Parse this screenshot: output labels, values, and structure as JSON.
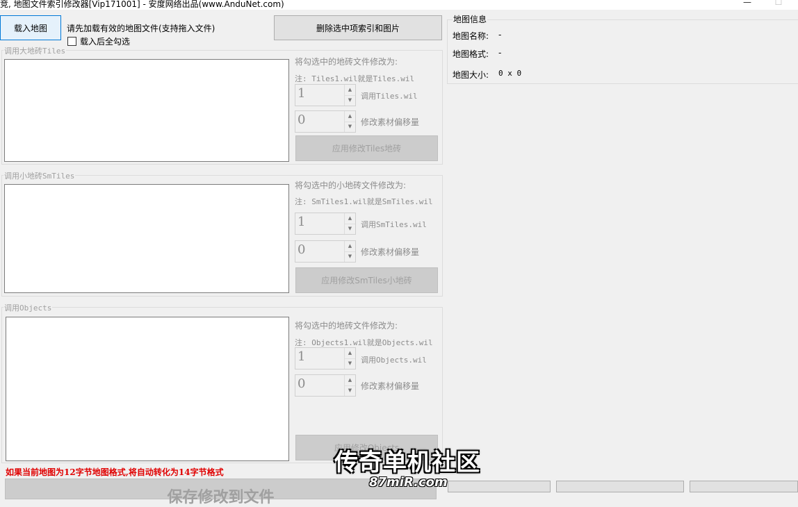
{
  "window": {
    "title": "竞, 地图文件索引修改器[Vip171001] - 安度网络出品(www.AnduNet.com)",
    "minimize_glyph": "—",
    "maximize_glyph": "☐"
  },
  "toolbar": {
    "load_map_button": "载入地图",
    "hint": "请先加载有效的地图文件(支持拖入文件)",
    "select_all_after_load": "载入后全勾选",
    "delete_button": "删除选中项索引和图片"
  },
  "tiles_group": {
    "title": "调用大地砖Tiles",
    "modify_label": "将勾选中的地砖文件修改为:",
    "note": "注: Tiles1.wil就是Tiles.wil",
    "call_value": "1",
    "call_label": "调用Tiles.wil",
    "offset_value": "0",
    "offset_label": "修改素材偏移量",
    "apply_button": "应用修改Tiles地砖"
  },
  "smtiles_group": {
    "title": "调用小地砖SmTiles",
    "modify_label": "将勾选中的小地砖文件修改为:",
    "note": "注: SmTiles1.wil就是SmTiles.wil",
    "call_value": "1",
    "call_label": "调用SmTiles.wil",
    "offset_value": "0",
    "offset_label": "修改素材偏移量",
    "apply_button": "应用修改SmTiles小地砖"
  },
  "objects_group": {
    "title": "调用Objects",
    "modify_label": "将勾选中的地砖文件修改为:",
    "note": "注: Objects1.wil就是Objects.wil",
    "call_value": "1",
    "call_label": "调用Objects.wil",
    "offset_value": "0",
    "offset_label": "修改素材偏移量",
    "apply_button": "应用修改Objects"
  },
  "warning": "如果当前地图为12字节地图格式,将自动转化为14字节格式",
  "save_button": "保存修改到文件",
  "map_info": {
    "title": "地图信息",
    "name_label": "地图名称:",
    "name_value": "-",
    "format_label": "地图格式:",
    "format_value": "-",
    "size_label": "地图大小:",
    "size_value": "0 x 0"
  },
  "watermark": {
    "text": "传奇单机社区",
    "url": "87miR.com"
  },
  "colors": {
    "warning": "#e00000",
    "accent": "#0078d7"
  }
}
